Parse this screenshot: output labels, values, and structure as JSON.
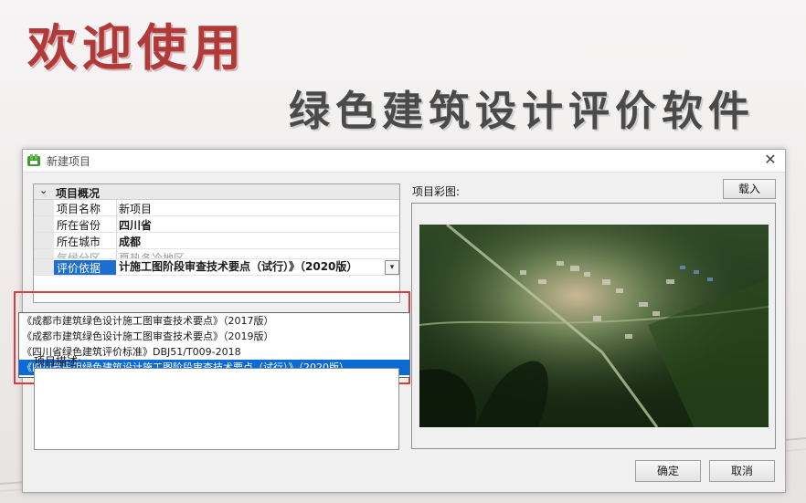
{
  "splash": {
    "title": "欢迎使用",
    "subtitle": "绿色建筑设计评价软件"
  },
  "dialog": {
    "title": "新建项目",
    "close_symbol": "✕",
    "app_icon": "app-logo-icon"
  },
  "overview": {
    "group_label": "项目概况",
    "rows": [
      {
        "name": "项目名称",
        "value": "新项目"
      },
      {
        "name": "所在省份",
        "value": "四川省"
      },
      {
        "name": "所在城市",
        "value": "成都"
      },
      {
        "name": "气候分区",
        "value": "夏热冬冷地区"
      },
      {
        "name": "评价依据",
        "value": "计施工图阶段审查技术要点（试行）》（2020版）"
      }
    ]
  },
  "dropdown": {
    "options": [
      "《成都市建筑绿色设计施工图审查技术要点》（2017版）",
      "《成都市建筑绿色设计施工图审查技术要点》（2019版）",
      "《四川省绿色建筑评价标准》DBJ51/T009-2018",
      "《四川省民用绿色建筑设计施工图阶段审查技术要点（试行）》（2020版）"
    ],
    "selected_index": 3
  },
  "description": {
    "label": "项目描述:",
    "value": ""
  },
  "image_panel": {
    "label": "项目彩图:",
    "load_button": "载入"
  },
  "buttons": {
    "ok": "确定",
    "cancel": "取消"
  },
  "colors": {
    "splash_title": "#b03a3a",
    "splash_subtitle": "#4a4a4a",
    "selection": "#0a6bd8",
    "highlight_frame": "#e23a3a"
  }
}
